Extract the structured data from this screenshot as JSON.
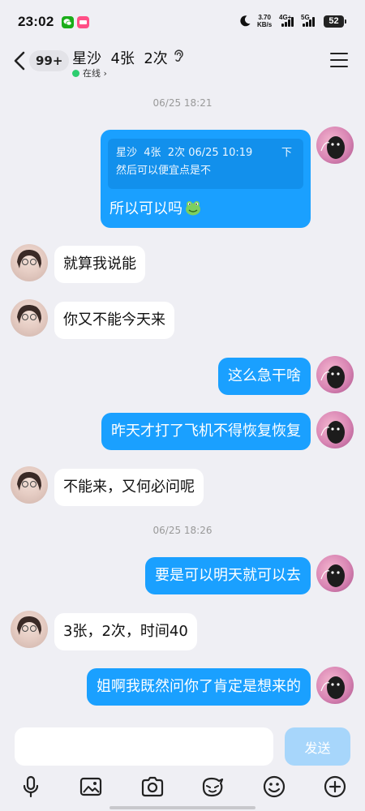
{
  "status_bar": {
    "time": "23:02",
    "net_speed_value": "3.70",
    "net_speed_unit": "KB/s",
    "network_label_1": "4G+",
    "network_label_2": "5G",
    "battery": "52"
  },
  "header": {
    "unread_count": "99+",
    "contact_name": "星沙  4张  2次",
    "status": "在线",
    "status_chevron": "›"
  },
  "colors": {
    "bubble_out": "#1aa0ff",
    "bubble_in": "#ffffff",
    "background": "#efeff4",
    "online": "#2dcd6f",
    "send_button": "#a7d6fb"
  },
  "chat": {
    "timestamp_1": "06/25 18:21",
    "timestamp_2": "06/25 18:26",
    "quote": {
      "meta": "星沙  4张  2次 06/25 10:19",
      "text": "然后可以便宜点是不",
      "arrow": "下"
    },
    "messages": [
      {
        "side": "out",
        "text": "所以可以吗",
        "emoji": "frog-emoji"
      },
      {
        "side": "in",
        "text": "就算我说能"
      },
      {
        "side": "in",
        "text": "你又不能今天来"
      },
      {
        "side": "out",
        "text": "这么急干啥"
      },
      {
        "side": "out",
        "text": "昨天才打了飞机不得恢复恢复"
      },
      {
        "side": "in",
        "text": "不能来，又何必问呢"
      },
      {
        "side": "out",
        "text": "要是可以明天就可以去"
      },
      {
        "side": "in",
        "text": "3张，2次，时间40"
      },
      {
        "side": "out",
        "text": "姐啊我既然问你了肯定是想来的"
      }
    ]
  },
  "input": {
    "placeholder": "",
    "value": "",
    "send_label": "发送"
  },
  "toolbar": {
    "icons": [
      "microphone-icon",
      "image-icon",
      "camera-icon",
      "sticker-icon",
      "emoji-icon",
      "plus-icon"
    ]
  }
}
